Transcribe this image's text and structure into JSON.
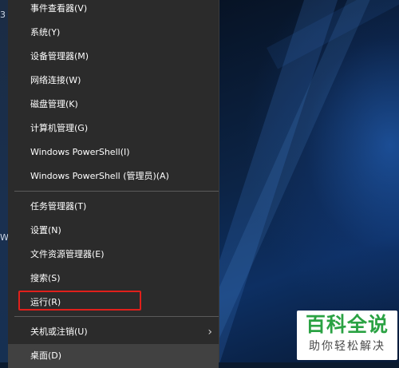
{
  "desktop_fragments": [
    "3",
    "W"
  ],
  "menu": {
    "items": [
      {
        "label": "事件查看器(V)"
      },
      {
        "label": "系统(Y)"
      },
      {
        "label": "设备管理器(M)"
      },
      {
        "label": "网络连接(W)"
      },
      {
        "label": "磁盘管理(K)"
      },
      {
        "label": "计算机管理(G)"
      },
      {
        "label": "Windows PowerShell(I)"
      },
      {
        "label": "Windows PowerShell (管理员)(A)"
      },
      {
        "label": "任务管理器(T)"
      },
      {
        "label": "设置(N)"
      },
      {
        "label": "文件资源管理器(E)"
      },
      {
        "label": "搜索(S)"
      },
      {
        "label": "运行(R)"
      },
      {
        "label": "关机或注销(U)",
        "submenu_arrow": "›"
      },
      {
        "label": "桌面(D)"
      }
    ]
  },
  "watermark": {
    "title": "百科全说",
    "subtitle": "助你轻松解决"
  },
  "colors": {
    "menu_bg": "#2b2b2b",
    "highlight_border": "#e0201b",
    "logo_green": "#2aa243"
  }
}
